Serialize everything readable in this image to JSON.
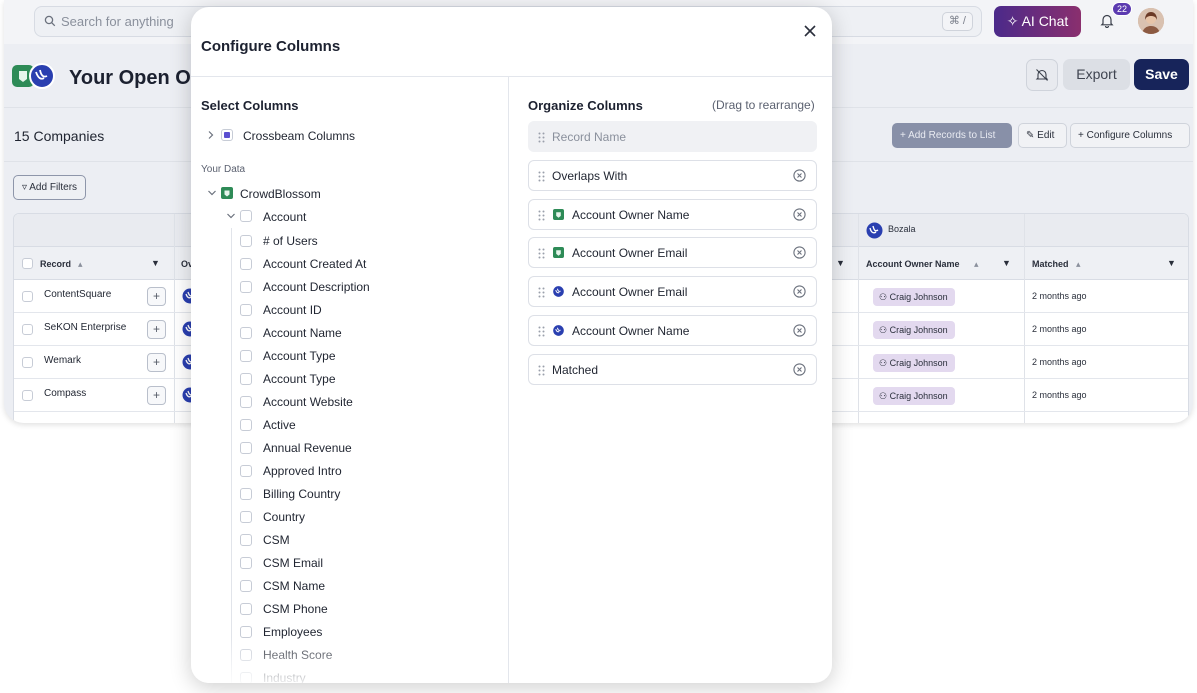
{
  "header": {
    "search_placeholder": "Search for anything",
    "search_shortcut": "⌘ /",
    "ai_chat_label": "AI Chat",
    "notification_count": "22"
  },
  "page": {
    "title": "Your Open Op",
    "mute_icon": "bell-off-icon",
    "export_label": "Export",
    "save_label": "Save",
    "company_count": "15 Companies",
    "add_records_label": "Add Records to List",
    "edit_label": "Edit",
    "configure_columns_label": "Configure Columns",
    "add_filters_label": "Add Filters"
  },
  "table": {
    "partner_group": "Bozala",
    "columns": {
      "record": "Record",
      "owner_short": "Ov",
      "account_owner_name": "Account Owner Name",
      "matched": "Matched"
    },
    "rows": [
      {
        "record": "ContentSquare",
        "owner": "Craig Johnson",
        "matched": "2 months ago"
      },
      {
        "record": "SeKON Enterprise",
        "owner": "Craig Johnson",
        "matched": "2 months ago"
      },
      {
        "record": "Wemark",
        "owner": "Craig Johnson",
        "matched": "2 months ago"
      },
      {
        "record": "Compass",
        "owner": "Craig Johnson",
        "matched": "2 months ago"
      }
    ]
  },
  "modal": {
    "title": "Configure Columns",
    "select_title": "Select Columns",
    "crossbeam_columns": "Crossbeam Columns",
    "your_data_label": "Your Data",
    "org_name": "CrowdBlossom",
    "object_name": "Account",
    "fields": [
      "# of Users",
      "Account Created At",
      "Account Description",
      "Account ID",
      "Account Name",
      "Account Type",
      "Account Type",
      "Account Website",
      "Active",
      "Annual Revenue",
      "Approved Intro",
      "Billing Country",
      "Country",
      "CSM",
      "CSM Email",
      "CSM Name",
      "CSM Phone",
      "Employees",
      "Health Score",
      "Industry"
    ],
    "organize_title": "Organize Columns",
    "drag_hint": "(Drag to rearrange)",
    "organized": [
      {
        "label": "Record Name",
        "source": "none",
        "locked": true
      },
      {
        "label": "Overlaps With",
        "source": "none",
        "locked": false
      },
      {
        "label": "Account Owner Name",
        "source": "crowdblossom",
        "locked": false
      },
      {
        "label": "Account Owner Email",
        "source": "crowdblossom",
        "locked": false
      },
      {
        "label": "Account Owner Email",
        "source": "bozala",
        "locked": false
      },
      {
        "label": "Account Owner Name",
        "source": "bozala",
        "locked": false
      },
      {
        "label": "Matched",
        "source": "none",
        "locked": false
      }
    ]
  },
  "colors": {
    "brand_navy": "#17245a",
    "crowdblossom_green": "#2e8b57",
    "bozala_blue": "#2a3fb0",
    "crossbeam_purple": "#5b4fd0"
  }
}
